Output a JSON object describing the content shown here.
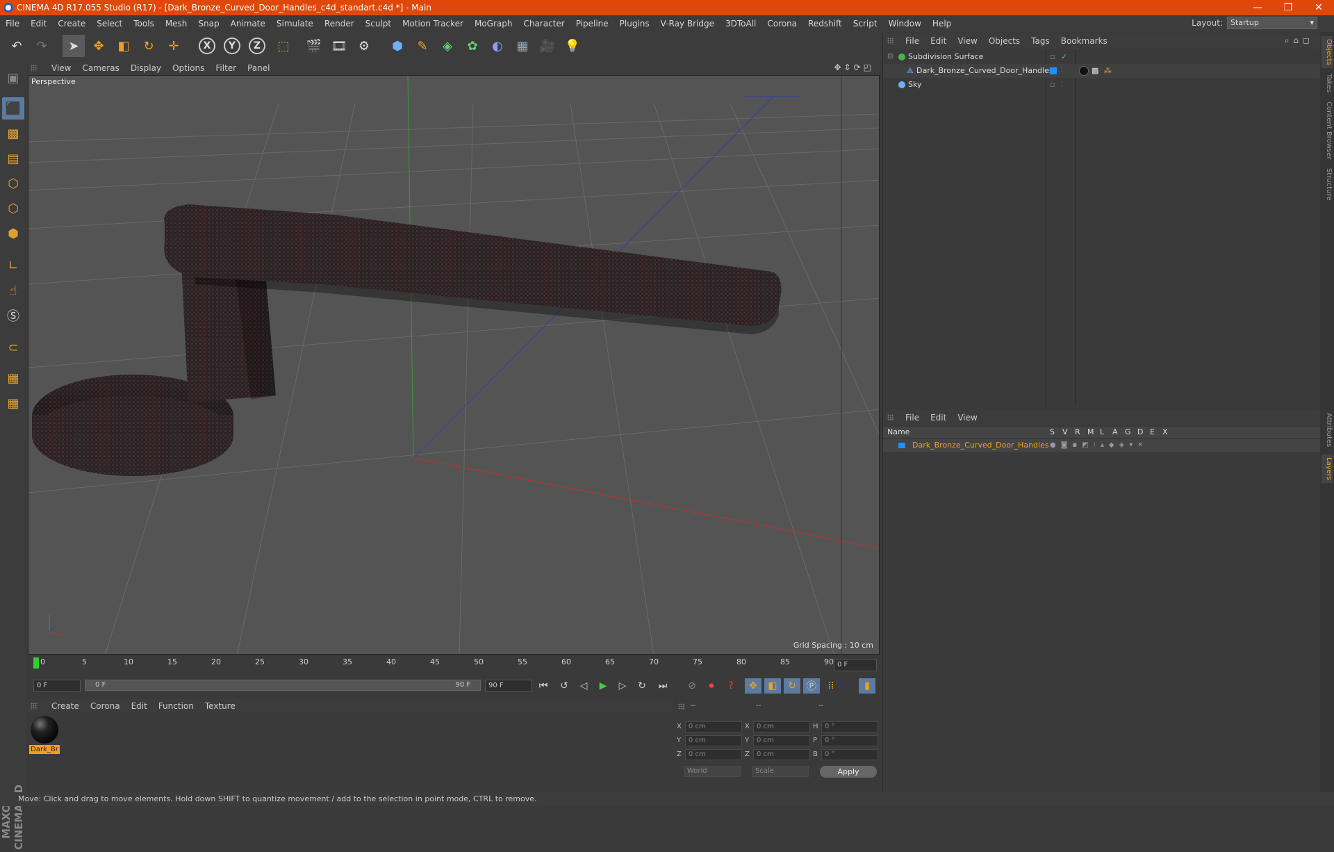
{
  "window": {
    "title": "CINEMA 4D R17.055 Studio (R17) - [Dark_Bronze_Curved_Door_Handles_c4d_standart.c4d *] - Main",
    "minimize_icon": "minimize-icon",
    "maximize_icon": "restore-icon",
    "close_icon": "close-icon"
  },
  "menubar": {
    "items": [
      "File",
      "Edit",
      "Create",
      "Select",
      "Tools",
      "Mesh",
      "Snap",
      "Animate",
      "Simulate",
      "Render",
      "Sculpt",
      "Motion Tracker",
      "MoGraph",
      "Character",
      "Pipeline",
      "Plugins",
      "V-Ray Bridge",
      "3DToAll",
      "Corona",
      "Redshift",
      "Script",
      "Window",
      "Help"
    ],
    "layout_label": "Layout:",
    "layout_value": "Startup"
  },
  "toolbar": {
    "axis": [
      "X",
      "Y",
      "Z"
    ]
  },
  "viewport": {
    "menu": [
      "View",
      "Cameras",
      "Display",
      "Options",
      "Filter",
      "Panel"
    ],
    "camera_label": "Perspective",
    "grid_spacing": "Grid Spacing : 10 cm"
  },
  "timeline": {
    "ticks": [
      "0",
      "5",
      "10",
      "15",
      "20",
      "25",
      "30",
      "35",
      "40",
      "45",
      "50",
      "55",
      "60",
      "65",
      "70",
      "75",
      "80",
      "85",
      "90"
    ],
    "current_frame": "0 F",
    "start_field": "0 F",
    "slider_start": "0 F",
    "slider_end": "90 F",
    "end_field": "90 F"
  },
  "material_manager": {
    "menu": [
      "Create",
      "Corona",
      "Edit",
      "Function",
      "Texture"
    ],
    "material_name": "Dark_Br"
  },
  "coordinates": {
    "headers": [
      "--",
      "--",
      "--"
    ],
    "rows": [
      {
        "a": "X",
        "v1": "0 cm",
        "b": "X",
        "v2": "0 cm",
        "c": "H",
        "v3": "0 °"
      },
      {
        "a": "Y",
        "v1": "0 cm",
        "b": "Y",
        "v2": "0 cm",
        "c": "P",
        "v3": "0 °"
      },
      {
        "a": "Z",
        "v1": "0 cm",
        "b": "Z",
        "v2": "0 cm",
        "c": "B",
        "v3": "0 °"
      }
    ],
    "world": "World",
    "scale": "Scale",
    "apply": "Apply"
  },
  "object_manager": {
    "menu": [
      "File",
      "Edit",
      "View",
      "Objects",
      "Tags",
      "Bookmarks"
    ],
    "objects": [
      "Subdivision Surface",
      "Dark_Bronze_Curved_Door_Handles",
      "Sky"
    ]
  },
  "layer_manager": {
    "menu": [
      "File",
      "Edit",
      "View"
    ],
    "header_name": "Name",
    "header_cols": [
      "S",
      "V",
      "R",
      "M",
      "L",
      "A",
      "G",
      "D",
      "E",
      "X"
    ],
    "layer_name": "Dark_Bronze_Curved_Door_Handles",
    "layer_color": "#1e90ff"
  },
  "right_tabs": [
    "Objects",
    "Takes",
    "Content Browser",
    "Structure",
    "Attributes",
    "Layers"
  ],
  "status": "Move: Click and drag to move elements. Hold down SHIFT to quantize movement / add to the selection in point mode, CTRL to remove.",
  "brand": "MAXON CINEMA 4D",
  "colors": {
    "accent": "#e0480a",
    "selection_orange": "#f0a020"
  }
}
